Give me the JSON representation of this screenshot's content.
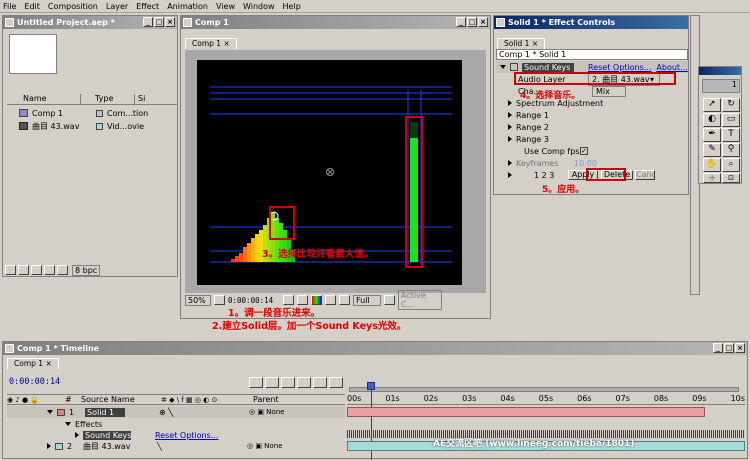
{
  "menu": [
    "File",
    "Edit",
    "Composition",
    "Layer",
    "Effect",
    "Animation",
    "View",
    "Window",
    "Help"
  ],
  "project": {
    "title": "Untitled Project.aep *",
    "columns": [
      "Name",
      "Type",
      "Si"
    ],
    "items": [
      {
        "name": "Comp 1",
        "type": "Com...tion"
      },
      {
        "name": "曲目 43.wav",
        "type": "Vid...ovie"
      }
    ],
    "bpc": "8 bpc"
  },
  "comp": {
    "title": "Comp 1",
    "tab": "Comp 1",
    "zoom": "50%",
    "time": "0:00:00:14",
    "resolution": "Full",
    "camera": "Active C..."
  },
  "effects": {
    "title": "Solid 1 * Effect Controls",
    "tab": "Solid 1",
    "header": "Comp 1 * Solid 1",
    "effect_name": "Sound Keys",
    "reset": "Reset Options...",
    "about": "About...",
    "audio_layer_label": "Audio Layer",
    "audio_layer_value": "2. 曲目 43.wav",
    "channel_label": "Cha...",
    "channel_value": "Mix",
    "spectrum": "Spectrum Adjustment",
    "range1": "Range 1",
    "range2": "Range 2",
    "range3": "Range 3",
    "use_comp_fps": "Use Comp fps",
    "keyframes_label": "Keyframes",
    "keyframes_value": "10.00",
    "nums": "1  2 3",
    "apply": "Apply",
    "delete": "Delete",
    "cancel": "Canc"
  },
  "annotations": {
    "step1": "1。调一段音乐进来。",
    "step2": "2.建立Solid层。加一个Sound Keys光效。",
    "step3": "3。选择比较好看最大值。",
    "step4": "4。选择音乐。",
    "step5": "5。应用。"
  },
  "tools": {
    "info": "1"
  },
  "timeline": {
    "title": "Comp 1 * Timeline",
    "tab": "Comp 1",
    "time": "0:00:00:14",
    "col_num": "#",
    "col_source": "Source Name",
    "col_parent": "Parent",
    "layers": [
      {
        "num": "1",
        "name": "Solid 1",
        "parent": "None"
      },
      {
        "num": "2",
        "name": "曲目 43.wav",
        "parent": "None"
      }
    ],
    "effects_label": "Effects",
    "sound_keys": "Sound Keys",
    "reset_options": "Reset Options...",
    "ticks": [
      "00s",
      "01s",
      "02s",
      "03s",
      "04s",
      "05s",
      "06s",
      "07s",
      "08s",
      "09s",
      "10s"
    ]
  },
  "watermark": "AE交流区吧 (www.lineeg.com/tieba/1801)"
}
